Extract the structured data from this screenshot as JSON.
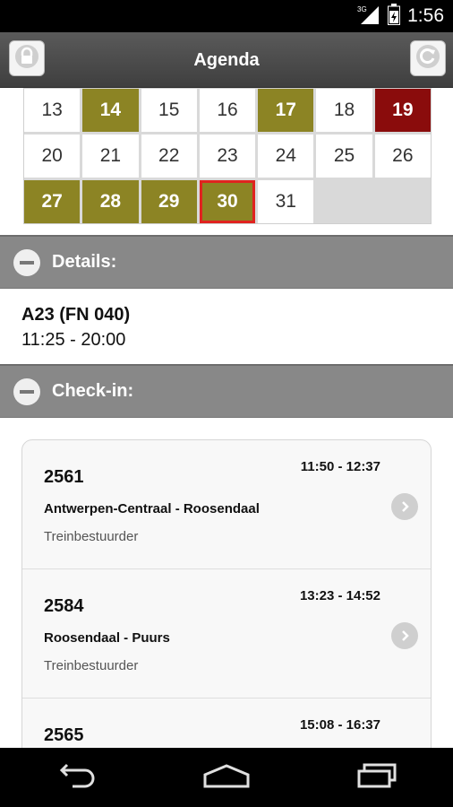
{
  "status_bar": {
    "network": "3G",
    "time": "1:56"
  },
  "header": {
    "title": "Agenda",
    "left_icon": "lock-icon",
    "right_icon": "refresh-icon"
  },
  "calendar": {
    "days": [
      {
        "label": "13",
        "state": "normal"
      },
      {
        "label": "14",
        "state": "event"
      },
      {
        "label": "15",
        "state": "normal"
      },
      {
        "label": "16",
        "state": "normal"
      },
      {
        "label": "17",
        "state": "event"
      },
      {
        "label": "18",
        "state": "normal"
      },
      {
        "label": "19",
        "state": "holiday"
      },
      {
        "label": "20",
        "state": "normal"
      },
      {
        "label": "21",
        "state": "normal"
      },
      {
        "label": "22",
        "state": "normal"
      },
      {
        "label": "23",
        "state": "normal"
      },
      {
        "label": "24",
        "state": "normal"
      },
      {
        "label": "25",
        "state": "normal"
      },
      {
        "label": "26",
        "state": "normal"
      },
      {
        "label": "27",
        "state": "event"
      },
      {
        "label": "28",
        "state": "event"
      },
      {
        "label": "29",
        "state": "event"
      },
      {
        "label": "30",
        "state": "today"
      },
      {
        "label": "31",
        "state": "normal"
      },
      {
        "label": "",
        "state": "empty"
      },
      {
        "label": "",
        "state": "empty"
      }
    ]
  },
  "details": {
    "label": "Details:",
    "line1": "A23 (FN 040)",
    "line2": "11:25 - 20:00"
  },
  "checkin": {
    "label": "Check-in:",
    "items": [
      {
        "number": "2561",
        "time": "11:50 - 12:37",
        "route": "Antwerpen-Centraal - Roosendaal",
        "role": "Treinbestuurder"
      },
      {
        "number": "2584",
        "time": "13:23 - 14:52",
        "route": "Roosendaal - Puurs",
        "role": "Treinbestuurder"
      },
      {
        "number": "2565",
        "time": "15:08 - 16:37",
        "route": "",
        "role": ""
      }
    ]
  },
  "colors": {
    "event": "#8c8424",
    "holiday": "#8a0c0c",
    "today_border": "#e0231f",
    "section_bar": "#888888",
    "header": "#4a4a4a"
  }
}
